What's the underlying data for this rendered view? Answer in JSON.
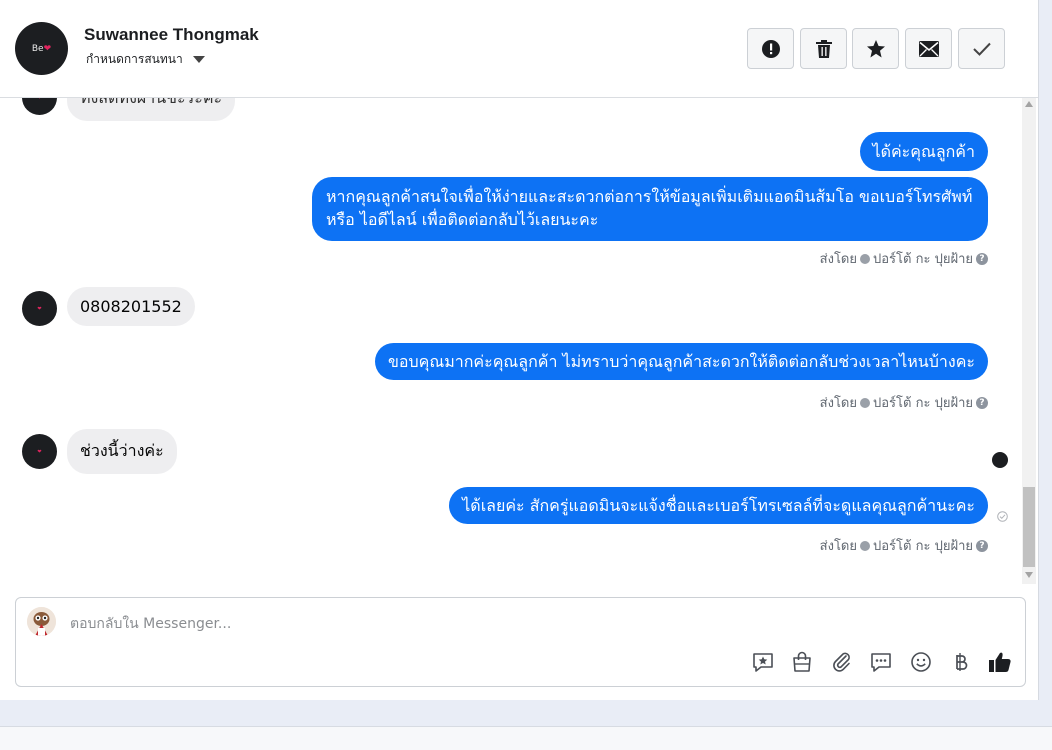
{
  "header": {
    "contact_name": "Suwannee Thongmak",
    "assign_label": "กำหนดการสนทนา",
    "avatar_text": "Be"
  },
  "header_buttons": [
    {
      "name": "report-spam",
      "icon": "alert-icon"
    },
    {
      "name": "delete",
      "icon": "trash-icon"
    },
    {
      "name": "star",
      "icon": "star-icon"
    },
    {
      "name": "mark-unread",
      "icon": "envelope-icon"
    },
    {
      "name": "mark-done",
      "icon": "check-icon"
    }
  ],
  "messages": {
    "partial_top": "ทั้งสัดทั้งผ่านชะระค่ะ",
    "out_1": "ได้ค่ะคุณลูกค้า",
    "out_2": "หากคุณลูกค้าสนใจเพื่อให้ง่ายและสะดวกต่อการให้ข้อมูลเพิ่มเติมแอดมินส้มโอ ขอเบอร์โทรศัพท์ หรือ ไอดีไลน์ เพื่อติดต่อกลับไว้เลยนะคะ",
    "in_phone": "0808201552",
    "out_3": "ขอบคุณมากค่ะคุณลูกค้า ไม่ทราบว่าคุณลูกค้าสะดวกให้ติดต่อกลับช่วงเวลาไหนบ้างคะ",
    "in_free": "ช่วงนี้ว่างค่ะ",
    "out_4": "ได้เลยค่ะ สักครู่แอดมินจะแจ้งชื่อและเบอร์โทรเซลล์ที่จะดูแลคุณลูกค้านะคะ"
  },
  "sent_by": {
    "prefix": "ส่งโดย",
    "agent": "ปอร์โต้ กะ ปุยฝ้าย"
  },
  "composer": {
    "placeholder": "ตอบกลับใน Messenger..."
  },
  "composer_tools": [
    "saved-reply-icon",
    "shop-bag-icon",
    "attachment-icon",
    "chat-icon",
    "emoji-icon",
    "baht-icon",
    "thumbs-up-icon"
  ],
  "colors": {
    "outgoing_bubble": "#0d72f4",
    "incoming_bubble": "#eeeef0"
  }
}
